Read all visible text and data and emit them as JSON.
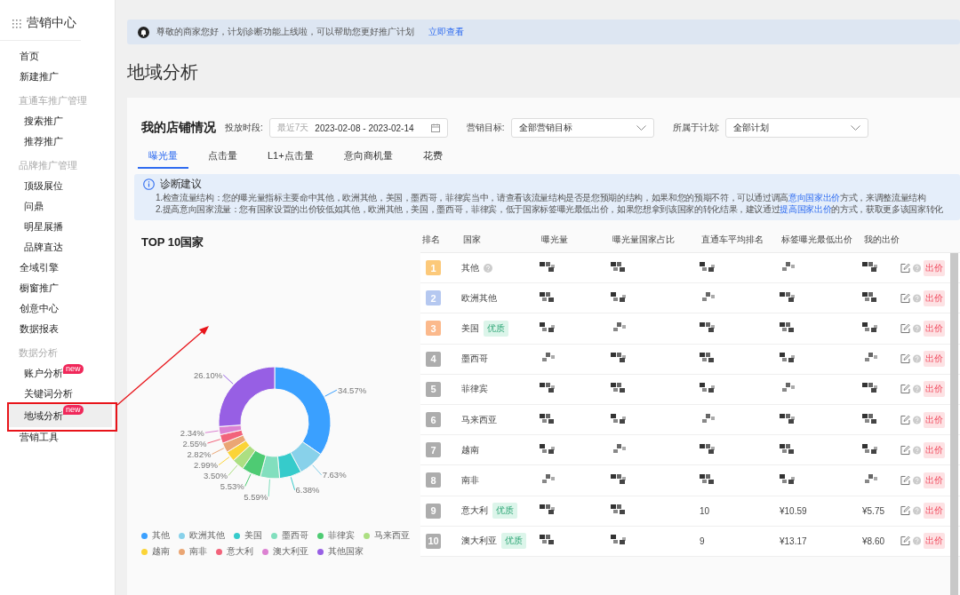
{
  "sidebar": {
    "title": "营销中心",
    "items": [
      {
        "kind": "item",
        "label": "首页",
        "selected": false
      },
      {
        "kind": "item",
        "label": "新建推广",
        "selected": false
      },
      {
        "kind": "group",
        "label": "直通车推广管理"
      },
      {
        "kind": "sub",
        "label": "搜索推广",
        "selected": false
      },
      {
        "kind": "sub",
        "label": "推荐推广",
        "selected": false
      },
      {
        "kind": "group",
        "label": "品牌推广管理"
      },
      {
        "kind": "sub",
        "label": "顶级展位",
        "selected": false
      },
      {
        "kind": "sub",
        "label": "问鼎",
        "selected": false
      },
      {
        "kind": "sub",
        "label": "明星展播",
        "selected": false
      },
      {
        "kind": "sub",
        "label": "品牌直达",
        "selected": false
      },
      {
        "kind": "item",
        "label": "全域引擎",
        "selected": false
      },
      {
        "kind": "item",
        "label": "橱窗推广",
        "selected": false
      },
      {
        "kind": "item",
        "label": "创意中心",
        "selected": false
      },
      {
        "kind": "item",
        "label": "数据报表",
        "selected": false
      },
      {
        "kind": "group",
        "label": "数据分析"
      },
      {
        "kind": "sub",
        "label": "账户分析",
        "badge": "new",
        "selected": false
      },
      {
        "kind": "sub",
        "label": "关键词分析",
        "selected": false
      },
      {
        "kind": "sub",
        "label": "地域分析",
        "badge": "new",
        "selected": true
      },
      {
        "kind": "item",
        "label": "营销工具",
        "selected": false
      }
    ]
  },
  "banner": {
    "text": "尊敬的商家您好，计划诊断功能上线啦，可以帮助您更好推广计划",
    "link": "立即查看"
  },
  "page_title": "地域分析",
  "store": {
    "title": "我的店铺情况",
    "filters": [
      {
        "kind": "date",
        "label": "投放时段:",
        "preset": "最近7天",
        "value": "2023-02-08 - 2023-02-14"
      },
      {
        "kind": "select",
        "label": "营销目标:",
        "value": "全部营销目标"
      },
      {
        "kind": "select",
        "label": "所属于计划:",
        "value": "全部计划"
      }
    ],
    "tabs": [
      {
        "label": "曝光量",
        "selected": true
      },
      {
        "label": "点击量",
        "selected": false
      },
      {
        "label": "L1+点击量",
        "selected": false
      },
      {
        "label": "意向商机量",
        "selected": false
      },
      {
        "label": "花费",
        "selected": false
      }
    ],
    "diagnosis": {
      "title": "诊断建议",
      "lines": [
        {
          "before": "1.检查流量结构：您的曝光量指标主要命中其他，欧洲其他，美国，墨西哥，菲律宾当中，请查看该流量结构是否是您预期的结构，如果和您的预期不符，可以通过调高",
          "link": "意向国家出价",
          "after": "方式，来调整流量结构"
        },
        {
          "before": "2.提高意向国家流量：您有国家设置的出价较低如其他，欧洲其他，美国，墨西哥，菲律宾，低于国家标签曝光最低出价，如果您想拿到该国家的转化结果，建议通过",
          "link": "提高国家出价",
          "after": "的方式，获取更多该国家转化"
        }
      ]
    }
  },
  "top10": {
    "title": "TOP 10国家",
    "chart_data": {
      "type": "donut",
      "categories": [
        "其他",
        "欧洲其他",
        "美国",
        "墨西哥",
        "菲律宾",
        "马来西亚",
        "越南",
        "南非",
        "意大利",
        "澳大利亚",
        "其他国家"
      ],
      "series": [
        {
          "colors": [
            "#3aa0ff",
            "#88d1ea",
            "#36cbcb",
            "#82dfbe",
            "#4ecb73",
            "#acdf82",
            "#fbd437",
            "#eaa674",
            "#f2637b",
            "#dc81d2",
            "#975fe4"
          ],
          "values": [
            34.57,
            7.63,
            6.38,
            5.59,
            5.53,
            3.5,
            2.99,
            2.82,
            2.55,
            2.34,
            26.1
          ]
        }
      ],
      "value_labels": [
        "34.57%",
        "7.63%",
        "6.38%",
        "5.59%",
        "5.53%",
        "3.50%",
        "2.99%",
        "2.82%",
        "2.55%",
        "2.34%",
        "26.10%"
      ]
    }
  },
  "table": {
    "columns": [
      "排名",
      "国家",
      "曝光量",
      "曝光量国家占比",
      "直通车平均排名",
      "标签曝光最低出价",
      "我的出价"
    ],
    "rows": [
      {
        "rank": "1",
        "color": "#fcc97a",
        "country": "其他",
        "help": true,
        "action": "出价",
        "cells": [
          {
            "kind": "masked"
          },
          {
            "kind": "masked"
          },
          {
            "kind": "masked"
          },
          {
            "kind": "masked"
          },
          {
            "kind": "masked"
          }
        ]
      },
      {
        "rank": "2",
        "color": "#b5c8f0",
        "country": "欧洲其他",
        "help": false,
        "action": "出价",
        "cells": [
          {
            "kind": "masked"
          },
          {
            "kind": "masked"
          },
          {
            "kind": "masked"
          },
          {
            "kind": "masked"
          },
          {
            "kind": "masked"
          }
        ]
      },
      {
        "rank": "3",
        "color": "#fbb98c",
        "country": "美国",
        "help": false,
        "action": "出价",
        "tag": "优质",
        "cells": [
          {
            "kind": "masked"
          },
          {
            "kind": "masked"
          },
          {
            "kind": "masked"
          },
          {
            "kind": "masked"
          },
          {
            "kind": "masked"
          }
        ]
      },
      {
        "rank": "4",
        "color": "#adadad",
        "country": "墨西哥",
        "help": false,
        "action": "出价",
        "cells": [
          {
            "kind": "masked"
          },
          {
            "kind": "masked"
          },
          {
            "kind": "masked"
          },
          {
            "kind": "masked"
          },
          {
            "kind": "masked"
          }
        ]
      },
      {
        "rank": "5",
        "color": "#adadad",
        "country": "菲律宾",
        "help": false,
        "action": "出价",
        "cells": [
          {
            "kind": "masked"
          },
          {
            "kind": "masked"
          },
          {
            "kind": "masked"
          },
          {
            "kind": "masked"
          },
          {
            "kind": "masked"
          }
        ]
      },
      {
        "rank": "6",
        "color": "#adadad",
        "country": "马来西亚",
        "help": false,
        "action": "出价",
        "cells": [
          {
            "kind": "masked"
          },
          {
            "kind": "masked"
          },
          {
            "kind": "masked"
          },
          {
            "kind": "masked"
          },
          {
            "kind": "masked"
          }
        ]
      },
      {
        "rank": "7",
        "color": "#adadad",
        "country": "越南",
        "help": false,
        "action": "出价",
        "cells": [
          {
            "kind": "masked"
          },
          {
            "kind": "masked"
          },
          {
            "kind": "masked"
          },
          {
            "kind": "masked"
          },
          {
            "kind": "masked"
          }
        ]
      },
      {
        "rank": "8",
        "color": "#adadad",
        "country": "南非",
        "help": false,
        "action": "出价",
        "cells": [
          {
            "kind": "masked"
          },
          {
            "kind": "masked"
          },
          {
            "kind": "masked"
          },
          {
            "kind": "masked"
          },
          {
            "kind": "masked"
          }
        ]
      },
      {
        "rank": "9",
        "color": "#adadad",
        "country": "意大利",
        "help": false,
        "action": "出价",
        "tag": "优质",
        "cells": [
          {
            "kind": "masked"
          },
          {
            "kind": "masked"
          },
          {
            "kind": "text",
            "text": "10"
          },
          {
            "kind": "text",
            "text": "¥10.59"
          },
          {
            "kind": "text",
            "text": "¥5.75"
          }
        ]
      },
      {
        "rank": "10",
        "color": "#adadad",
        "country": "澳大利亚",
        "help": false,
        "action": "出价",
        "tag": "优质",
        "cells": [
          {
            "kind": "masked"
          },
          {
            "kind": "masked"
          },
          {
            "kind": "text",
            "text": "9"
          },
          {
            "kind": "text",
            "text": "¥13.17"
          },
          {
            "kind": "text",
            "text": "¥8.60"
          }
        ]
      }
    ]
  }
}
